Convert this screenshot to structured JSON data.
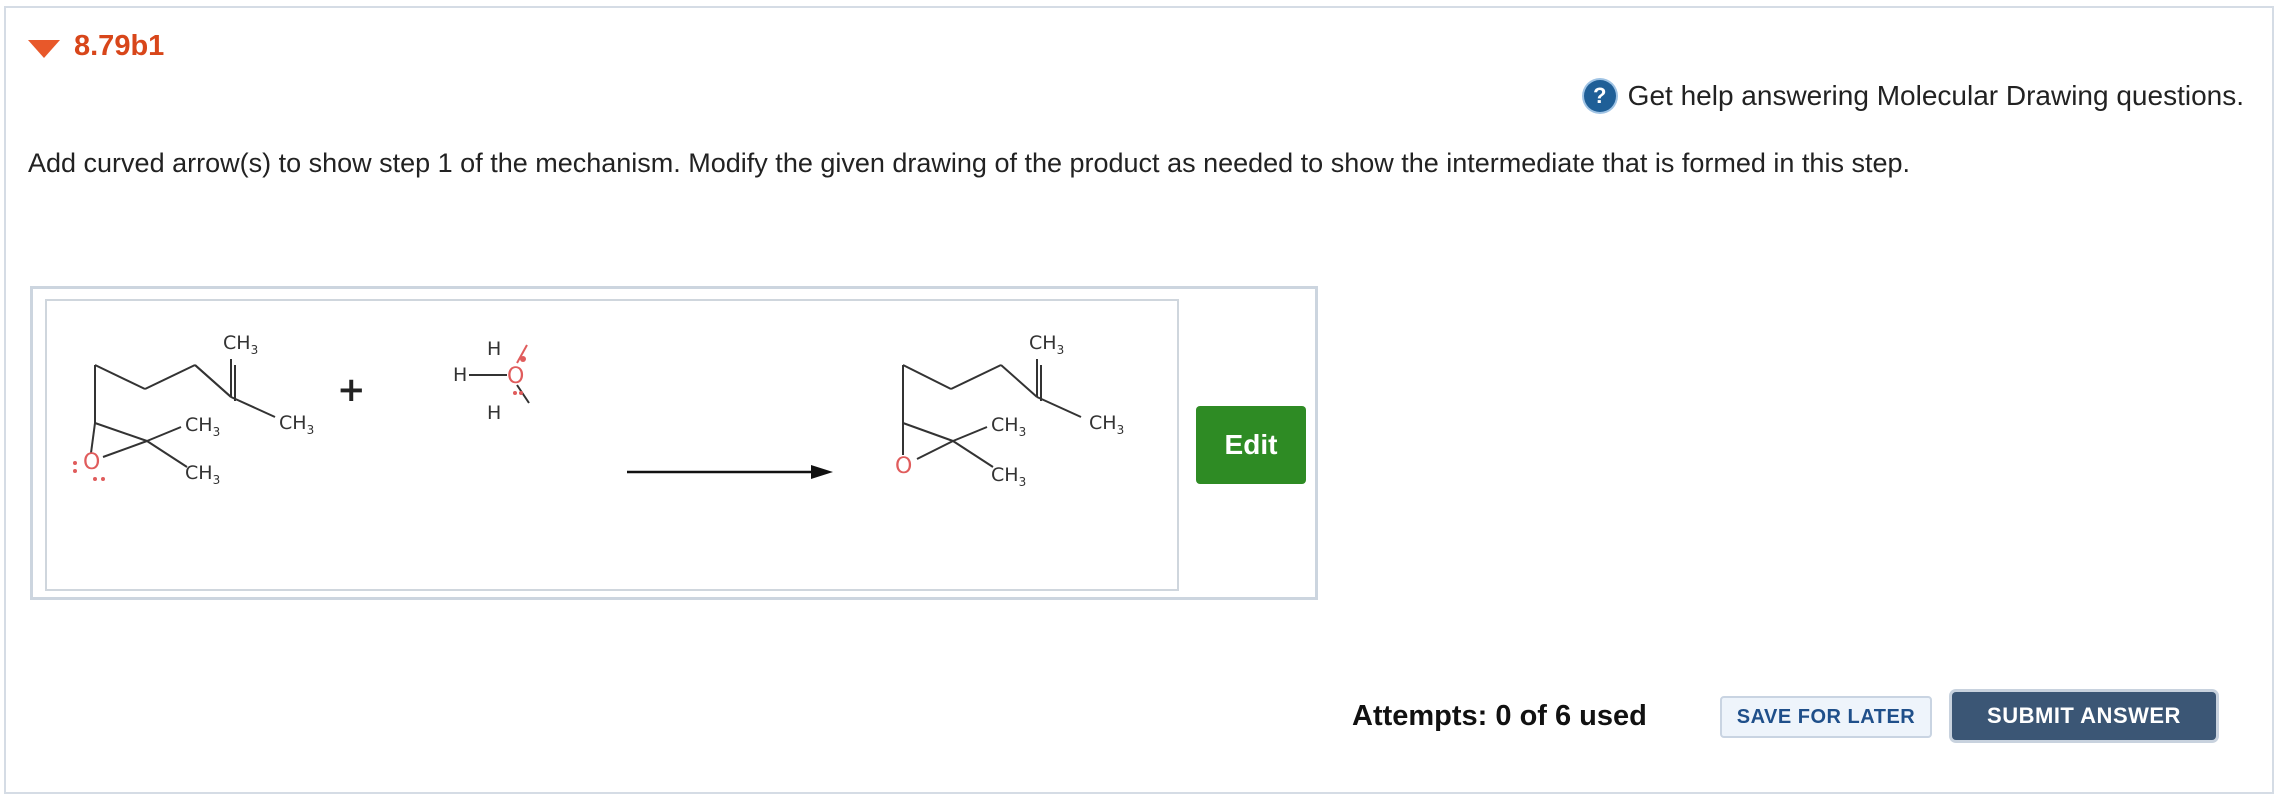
{
  "question": {
    "number": "8.79b1",
    "prompt": "Add curved arrow(s) to show step 1 of the mechanism. Modify the given drawing of the product as needed to show the intermediate that is formed in this step."
  },
  "help": {
    "label": "Get help answering Molecular Drawing questions.",
    "icon": "question-circle-icon"
  },
  "drawing": {
    "methyl_label": "CH",
    "methyl_subscript": "3",
    "oxygen_label": "O",
    "hydrogen_label": "H",
    "plus": "+",
    "edit_label": "Edit"
  },
  "footer": {
    "attempts": "Attempts: 0 of 6 used",
    "save_label": "SAVE FOR LATER",
    "submit_label": "SUBMIT ANSWER"
  },
  "colors": {
    "accent_orange": "#d8461a",
    "edit_green": "#2e8b24",
    "submit_navy": "#3b5675",
    "oxygen_red": "#e05c5c"
  }
}
